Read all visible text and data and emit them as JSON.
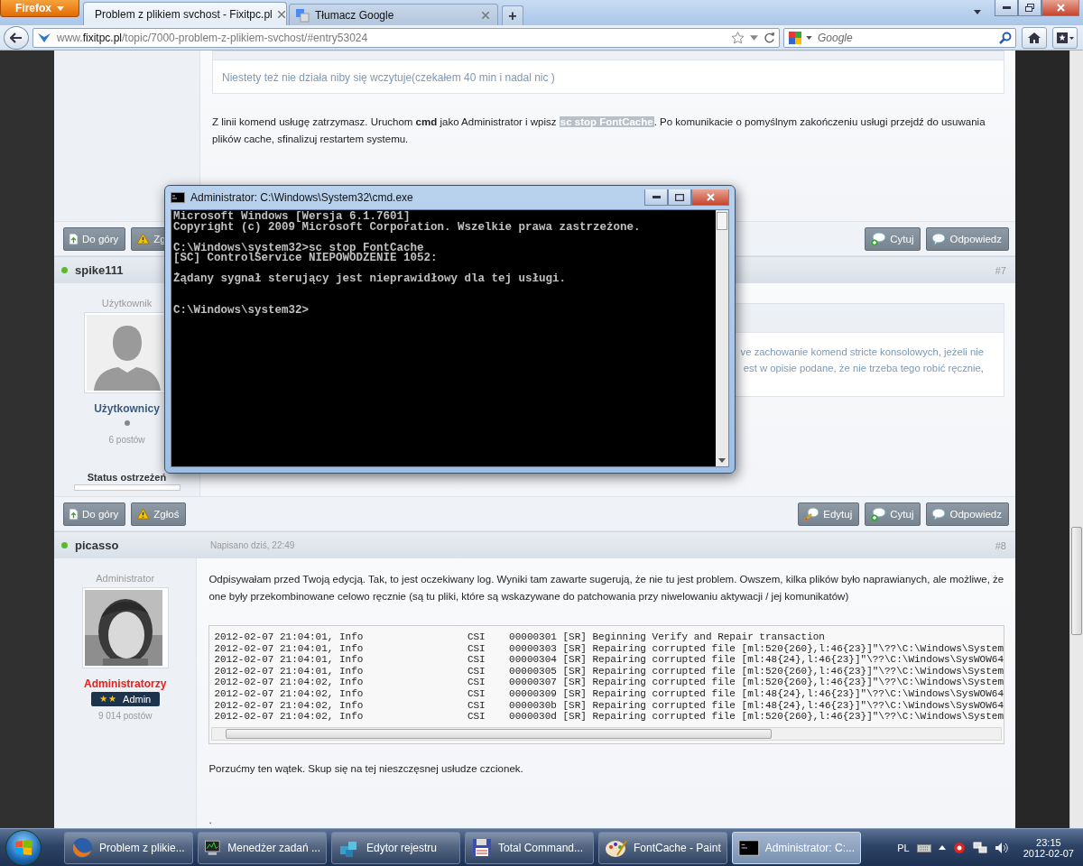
{
  "browser": {
    "menu_button": "Firefox",
    "tabs": [
      {
        "kind": "site",
        "title": "Problem z plikiem svchost - Fixitpc.pl",
        "selected": true
      },
      {
        "kind": "translate",
        "title": "Tłumacz Google",
        "selected": false
      }
    ],
    "new_tab": "+",
    "url": "www.**fixitpc.pl**/topic/7000-problem-z-plikiem-svchost/#entry53024",
    "search": {
      "placeholder": "Google"
    }
  },
  "posts": [
    {
      "quote": "Niestety też nie działa niby się wczytuje(czekałem 40 min i nadal nic )",
      "paragraph": {
        "before": "Z linii komend usługę zatrzymasz. Uruchom **cmd** jako Administrator i wpisz ",
        "code": "sc stop FontCache",
        "after": ". Po komunikacie o pomyślnym zakończeniu usługi przejdź do usuwania plików cache, sfinalizuj restartem systemu."
      },
      "actions": {
        "left": [
          {
            "kind": "top",
            "label": "Do góry"
          },
          {
            "kind": "report",
            "label": "Zg"
          }
        ],
        "right": [
          {
            "kind": "quote",
            "label": "Cytuj"
          },
          {
            "kind": "reply",
            "label": "Odpowiedz"
          }
        ]
      }
    },
    {
      "author": "spike111",
      "online": true,
      "number": "#7",
      "role": "Użytkownik",
      "avatar": {
        "kind": "silhouette"
      },
      "group": {
        "name": "Użytkownicy",
        "color": "#3d5b7d"
      },
      "post_count": "6 postów",
      "warning": {
        "label": "Status ostrzeżeń",
        "level": 0
      },
      "quote_lines": [
        "ve zachowanie komend stricte konsolowych, jeżeli nie",
        "est w opisie podane, że nie trzeba tego robić ręcznie,"
      ],
      "actions": {
        "left": [
          {
            "kind": "top",
            "label": "Do góry"
          },
          {
            "kind": "report",
            "label": "Zgłoś"
          }
        ],
        "right": [
          {
            "kind": "edit",
            "label": "Edytuj"
          },
          {
            "kind": "quote",
            "label": "Cytuj"
          },
          {
            "kind": "reply",
            "label": "Odpowiedz"
          }
        ]
      }
    },
    {
      "author": "picasso",
      "online": true,
      "date": "Napisano dziś, 22:49",
      "number": "#8",
      "role": "Administrator",
      "avatar": {
        "kind": "picture"
      },
      "group": {
        "name": "Administratorzy",
        "color": "#e8201c"
      },
      "badge": {
        "symbols": "★★",
        "label": "Admin"
      },
      "post_count": "9 014 postów",
      "paragraph": {
        "before": "Odpisywałam przed Twoją edycją. Tak, to jest oczekiwany log. Wyniki tam zawarte sugerują, że nie tu jest problem. Owszem, kilka plików było naprawianych, ale możliwe, że one były przekombinowane celowo ręcznie (są tu pliki, które są wskazywane do patchowania przy niwelowaniu aktywacji / jej komunikatów)"
      },
      "log": [
        {
          "time": "2012-02-07 21:04:01, Info",
          "source": "CSI",
          "id": "00000301",
          "message": "[SR] Beginning Verify and Repair transaction"
        },
        {
          "time": "2012-02-07 21:04:01, Info",
          "source": "CSI",
          "id": "00000303",
          "message": "[SR] Repairing corrupted file [ml:520{260},l:46{23}]\"\\??\\C:\\Windows\\System"
        },
        {
          "time": "2012-02-07 21:04:01, Info",
          "source": "CSI",
          "id": "00000304",
          "message": "[SR] Repairing corrupted file [ml:48{24},l:46{23}]\"\\??\\C:\\Windows\\SysWOW64"
        },
        {
          "time": "2012-02-07 21:04:01, Info",
          "source": "CSI",
          "id": "00000305",
          "message": "[SR] Repairing corrupted file [ml:520{260},l:46{23}]\"\\??\\C:\\Windows\\System"
        },
        {
          "time": "2012-02-07 21:04:02, Info",
          "source": "CSI",
          "id": "00000307",
          "message": "[SR] Repairing corrupted file [ml:520{260},l:46{23}]\"\\??\\C:\\Windows\\System"
        },
        {
          "time": "2012-02-07 21:04:02, Info",
          "source": "CSI",
          "id": "00000309",
          "message": "[SR] Repairing corrupted file [ml:48{24},l:46{23}]\"\\??\\C:\\Windows\\SysWOW64"
        },
        {
          "time": "2012-02-07 21:04:02, Info",
          "source": "CSI",
          "id": "0000030b",
          "message": "[SR] Repairing corrupted file [ml:48{24},l:46{23}]\"\\??\\C:\\Windows\\SysWOW64"
        },
        {
          "time": "2012-02-07 21:04:02, Info",
          "source": "CSI",
          "id": "0000030d",
          "message": "[SR] Repairing corrupted file [ml:520{260},l:46{23}]\"\\??\\C:\\Windows\\System"
        }
      ],
      "after_log": [
        "Porzućmy ten wątek. Skup się na tej nieszczęsnej usłudze czcionek.",
        "."
      ]
    }
  ],
  "console": {
    "title": "Administrator: C:\\Windows\\System32\\cmd.exe",
    "blocks": [
      [
        "Microsoft Windows [Wersja 6.1.7601]",
        "Copyright (c) 2009 Microsoft Corporation. Wszelkie prawa zastrzeżone."
      ],
      [
        "C:\\Windows\\system32>sc stop FontCache",
        "[SC] ControlService NIEPOWODZENIE 1052:"
      ],
      [
        "Żądany sygnał sterujący jest nieprawidłowy dla tej usługi."
      ],
      [
        "C:\\Windows\\system32>"
      ]
    ]
  },
  "taskbar": {
    "items": [
      {
        "kind": "firefox",
        "label": "Problem z plikie...",
        "selected": false
      },
      {
        "kind": "taskmgr",
        "label": "Menedżer zadań ...",
        "selected": false
      },
      {
        "kind": "regedit",
        "label": "Edytor rejestru",
        "selected": false
      },
      {
        "kind": "floppy",
        "label": "Total Command...",
        "selected": false
      },
      {
        "kind": "paint",
        "label": "FontCache - Paint",
        "selected": false
      },
      {
        "kind": "console",
        "label": "Administrator: C:...",
        "selected": true
      }
    ],
    "language": "PL",
    "time": "23:15",
    "date": "2012-02-07"
  }
}
